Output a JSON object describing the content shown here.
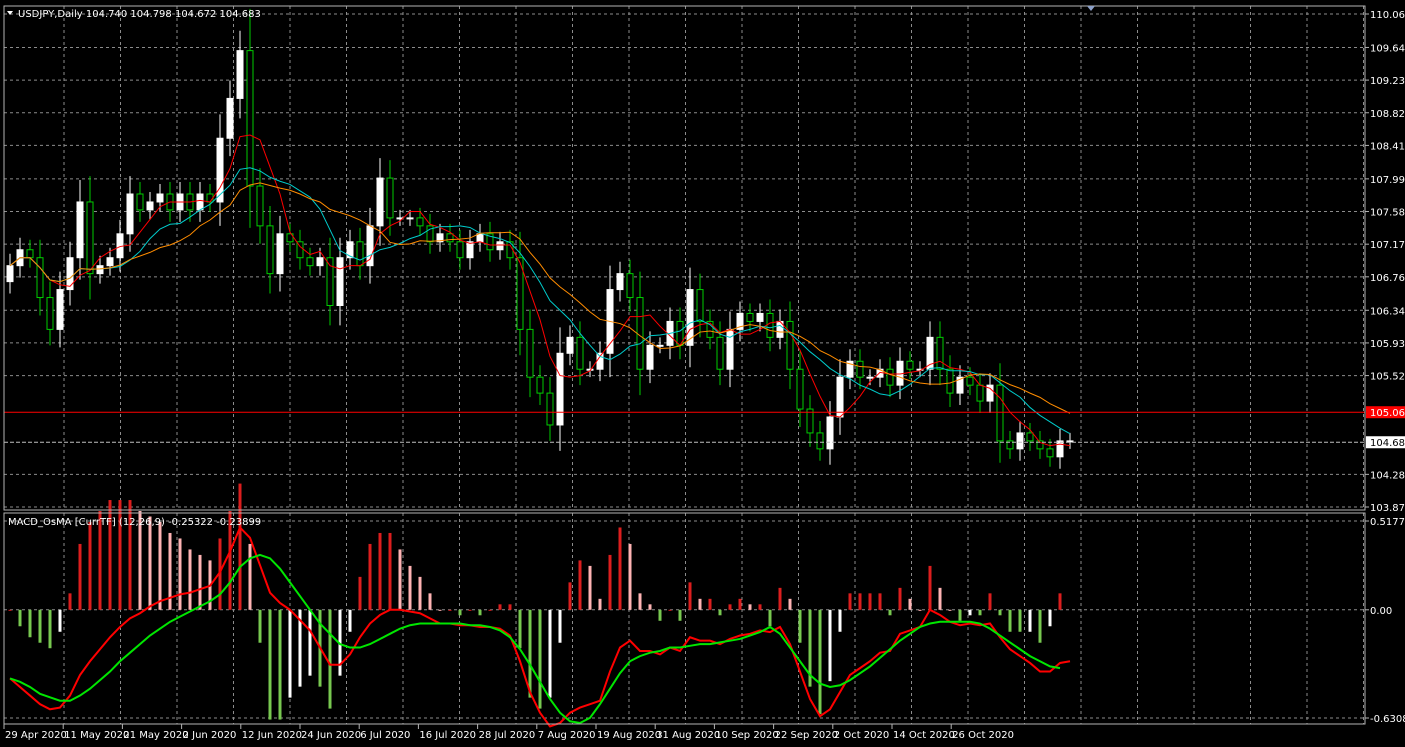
{
  "main_header": "USDJPY,Daily  104.740 104.798 104.672 104.683",
  "osc_header": "MACD_OsMA [CurrTF] (12,26,9) -0.25322 -0.23899",
  "colors": {
    "background": "#000000",
    "grid": "#8c8c8c",
    "bull": "#ffffff",
    "bear": "#00cc00",
    "ma_fast": "#ff0000",
    "ma_mid": "#00cccc",
    "ma_slow": "#ff8c00",
    "hline": "#ff0000",
    "bid_line": "#c0c0c0",
    "hist_pos_up": "#dc1e1e",
    "hist_pos_down": "#ffb4b4",
    "hist_neg_down": "#78c850",
    "hist_neg_up": "#ffffff",
    "macd_line": "#ff0000",
    "signal_line": "#00e600"
  },
  "chart_data": [
    {
      "type": "candlestick",
      "title": "USDJPY,Daily",
      "ohlc_shown": [
        "104.740",
        "104.798",
        "104.672",
        "104.683"
      ],
      "y_ticks": [
        "110.060",
        "109.640",
        "109.230",
        "108.820",
        "108.410",
        "107.990",
        "107.580",
        "107.170",
        "106.760",
        "106.340",
        "105.930",
        "105.520",
        "104.280",
        "103.870"
      ],
      "ylim": [
        103.87,
        110.06
      ],
      "x_ticks": [
        "29 Apr 2020",
        "11 May 2020",
        "21 May 2020",
        "2 Jun 2020",
        "12 Jun 2020",
        "24 Jun 2020",
        "6 Jul 2020",
        "16 Jul 2020",
        "28 Jul 2020",
        "7 Aug 2020",
        "19 Aug 2020",
        "31 Aug 2020",
        "10 Sep 2020",
        "22 Sep 2020",
        "2 Oct 2020",
        "14 Oct 2020",
        "26 Oct 2020"
      ],
      "hline_level": 105.06,
      "hline_label": "105.060",
      "bid_level": 104.683,
      "bid_label": "104.683",
      "close": [
        106.9,
        107.1,
        107.0,
        106.5,
        106.1,
        106.6,
        107.0,
        107.7,
        106.8,
        106.9,
        107.0,
        107.3,
        107.8,
        107.6,
        107.7,
        107.8,
        107.6,
        107.8,
        107.6,
        107.8,
        107.7,
        108.5,
        109.0,
        109.6,
        107.9,
        107.4,
        106.8,
        107.3,
        107.2,
        107.0,
        106.9,
        107.0,
        106.4,
        107.0,
        107.2,
        106.9,
        107.4,
        108.0,
        107.5,
        107.5,
        107.5,
        107.4,
        107.2,
        107.3,
        107.2,
        107.0,
        107.2,
        107.3,
        107.1,
        107.2,
        107.0,
        106.1,
        105.5,
        105.3,
        104.9,
        105.8,
        106.0,
        105.6,
        105.6,
        105.8,
        106.6,
        106.8,
        106.5,
        105.6,
        105.9,
        105.9,
        106.2,
        105.9,
        106.6,
        106.2,
        106.0,
        105.6,
        106.1,
        106.3,
        106.2,
        106.3,
        106.0,
        106.2,
        105.6,
        105.1,
        104.8,
        104.6,
        105.0,
        105.5,
        105.7,
        105.5,
        105.5,
        105.6,
        105.4,
        105.7,
        105.6,
        105.6,
        106.0,
        105.6,
        105.3,
        105.5,
        105.4,
        105.2,
        105.4,
        104.7,
        104.6,
        104.8,
        104.7,
        104.6,
        104.5,
        104.7,
        104.7
      ]
    },
    {
      "type": "bar",
      "title": "MACD_OsMA [CurrTF] (12,26,9)",
      "values_shown": [
        "-0.25322",
        "-0.23899"
      ],
      "y_ticks": [
        "0.51779",
        "0.00",
        "-0.63084"
      ],
      "ylim": [
        -0.63084,
        0.51779
      ],
      "macd": [
        -0.4,
        -0.45,
        -0.5,
        -0.55,
        -0.58,
        -0.57,
        -0.5,
        -0.38,
        -0.3,
        -0.23,
        -0.16,
        -0.1,
        -0.05,
        -0.02,
        0.02,
        0.05,
        0.07,
        0.09,
        0.1,
        0.12,
        0.14,
        0.22,
        0.34,
        0.48,
        0.42,
        0.26,
        0.1,
        0.04,
        0.0,
        -0.06,
        -0.12,
        -0.22,
        -0.32,
        -0.32,
        -0.26,
        -0.16,
        -0.08,
        -0.03,
        0.0,
        0.0,
        -0.01,
        -0.02,
        -0.05,
        -0.08,
        -0.08,
        -0.09,
        -0.09,
        -0.1,
        -0.1,
        -0.11,
        -0.15,
        -0.3,
        -0.48,
        -0.6,
        -0.68,
        -0.66,
        -0.6,
        -0.57,
        -0.55,
        -0.53,
        -0.36,
        -0.22,
        -0.18,
        -0.24,
        -0.24,
        -0.26,
        -0.22,
        -0.24,
        -0.16,
        -0.18,
        -0.18,
        -0.2,
        -0.17,
        -0.15,
        -0.14,
        -0.12,
        -0.13,
        -0.1,
        -0.2,
        -0.36,
        -0.52,
        -0.62,
        -0.58,
        -0.48,
        -0.38,
        -0.34,
        -0.3,
        -0.25,
        -0.24,
        -0.14,
        -0.12,
        -0.1,
        0.0,
        -0.03,
        -0.07,
        -0.09,
        -0.08,
        -0.09,
        -0.08,
        -0.16,
        -0.23,
        -0.27,
        -0.31,
        -0.36,
        -0.36,
        -0.31,
        -0.3
      ],
      "signal": [
        -0.4,
        -0.42,
        -0.45,
        -0.49,
        -0.51,
        -0.53,
        -0.53,
        -0.5,
        -0.46,
        -0.41,
        -0.36,
        -0.3,
        -0.25,
        -0.2,
        -0.15,
        -0.11,
        -0.07,
        -0.04,
        -0.01,
        0.02,
        0.05,
        0.09,
        0.16,
        0.25,
        0.3,
        0.32,
        0.3,
        0.24,
        0.16,
        0.08,
        0.0,
        -0.08,
        -0.14,
        -0.2,
        -0.22,
        -0.22,
        -0.2,
        -0.17,
        -0.14,
        -0.11,
        -0.09,
        -0.08,
        -0.08,
        -0.08,
        -0.08,
        -0.08,
        -0.09,
        -0.09,
        -0.1,
        -0.12,
        -0.16,
        -0.23,
        -0.32,
        -0.42,
        -0.52,
        -0.6,
        -0.65,
        -0.66,
        -0.63,
        -0.55,
        -0.46,
        -0.37,
        -0.3,
        -0.27,
        -0.25,
        -0.24,
        -0.22,
        -0.22,
        -0.21,
        -0.2,
        -0.2,
        -0.19,
        -0.18,
        -0.17,
        -0.15,
        -0.13,
        -0.1,
        -0.14,
        -0.22,
        -0.3,
        -0.38,
        -0.43,
        -0.45,
        -0.44,
        -0.41,
        -0.37,
        -0.33,
        -0.28,
        -0.23,
        -0.18,
        -0.14,
        -0.1,
        -0.08,
        -0.07,
        -0.07,
        -0.07,
        -0.07,
        -0.08,
        -0.11,
        -0.15,
        -0.19,
        -0.23,
        -0.27,
        -0.3,
        -0.33,
        -0.34
      ]
    }
  ]
}
